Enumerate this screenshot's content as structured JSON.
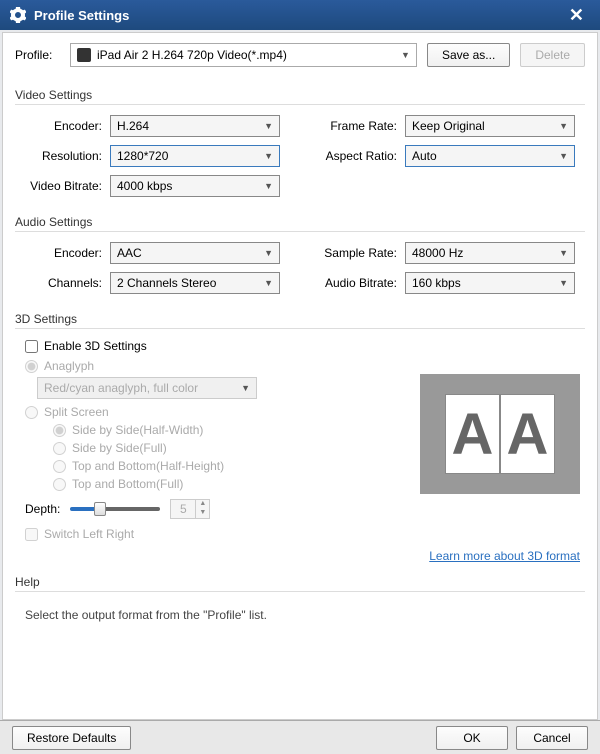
{
  "window": {
    "title": "Profile Settings"
  },
  "profile": {
    "label": "Profile:",
    "value": "iPad Air 2 H.264 720p Video(*.mp4)",
    "save_as_label": "Save as...",
    "delete_label": "Delete"
  },
  "video": {
    "legend": "Video Settings",
    "encoder_label": "Encoder:",
    "encoder": "H.264",
    "resolution_label": "Resolution:",
    "resolution": "1280*720",
    "framerate_label": "Frame Rate:",
    "framerate": "Keep Original",
    "aspect_label": "Aspect Ratio:",
    "aspect": "Auto",
    "bitrate_label": "Video Bitrate:",
    "bitrate": "4000 kbps"
  },
  "audio": {
    "legend": "Audio Settings",
    "encoder_label": "Encoder:",
    "encoder": "AAC",
    "channels_label": "Channels:",
    "channels": "2 Channels Stereo",
    "samplerate_label": "Sample Rate:",
    "samplerate": "48000 Hz",
    "bitrate_label": "Audio Bitrate:",
    "bitrate": "160 kbps"
  },
  "threeD": {
    "legend": "3D Settings",
    "enable_label": "Enable 3D Settings",
    "anaglyph_label": "Anaglyph",
    "anaglyph_mode": "Red/cyan anaglyph, full color",
    "split_label": "Split Screen",
    "opts": {
      "sbs_half": "Side by Side(Half-Width)",
      "sbs_full": "Side by Side(Full)",
      "tb_half": "Top and Bottom(Half-Height)",
      "tb_full": "Top and Bottom(Full)"
    },
    "depth_label": "Depth:",
    "depth_value": "5",
    "switch_label": "Switch Left Right",
    "link": "Learn more about 3D format"
  },
  "help": {
    "legend": "Help",
    "text": "Select the output format from the \"Profile\" list."
  },
  "footer": {
    "restore": "Restore Defaults",
    "ok": "OK",
    "cancel": "Cancel"
  }
}
